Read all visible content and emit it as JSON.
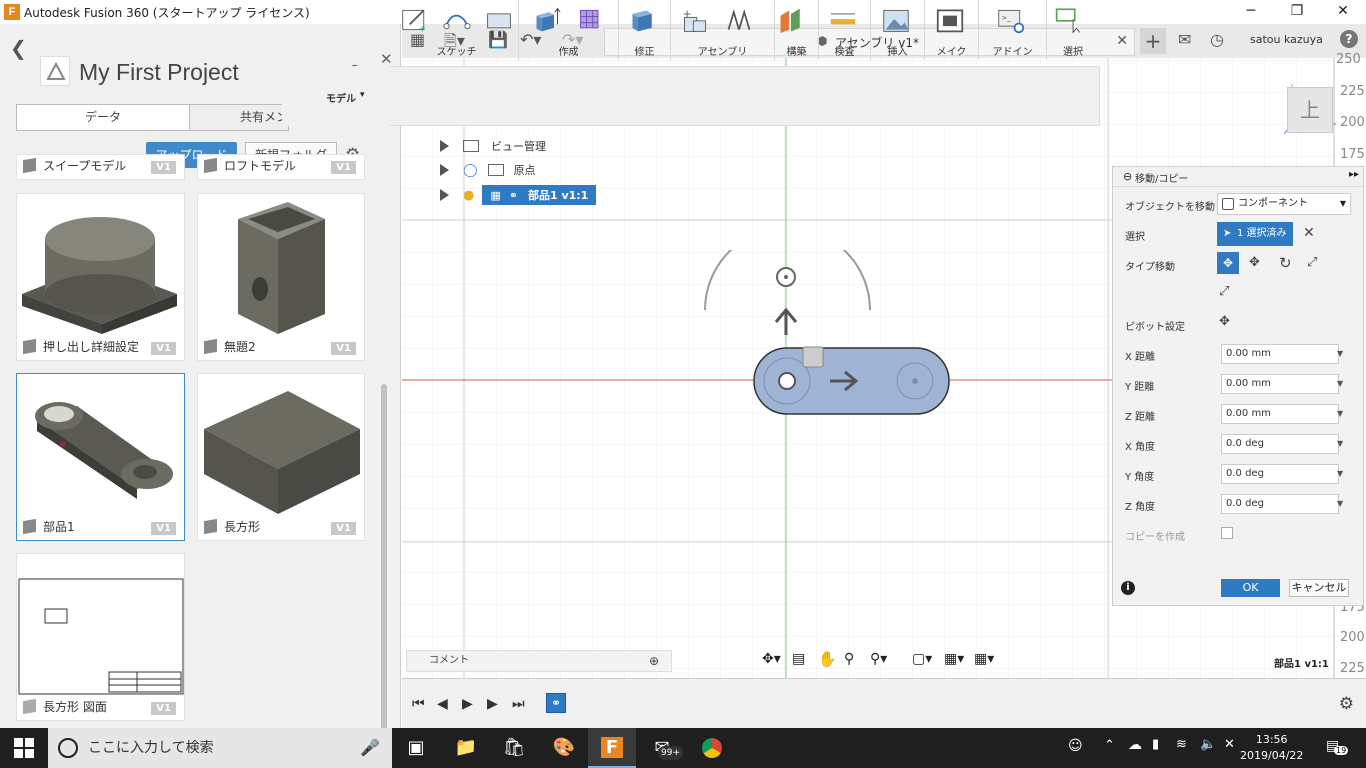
{
  "window": {
    "title": "Autodesk Fusion 360 (スタートアップ ライセンス)",
    "logo_letter": "F",
    "minimize": "─",
    "maximize": "❐",
    "close": "✕"
  },
  "data_panel": {
    "project_title": "My First Project",
    "tabs": [
      "データ",
      "共有メン"
    ],
    "upload_label": "アップロード",
    "new_folder_label": "新規フォルダ",
    "items": [
      {
        "name": "スイープモデル",
        "version": "V1"
      },
      {
        "name": "ロフトモデル",
        "version": "V1"
      },
      {
        "name": "押し出し詳細設定",
        "version": "V1"
      },
      {
        "name": "無題2",
        "version": "V1"
      },
      {
        "name": "部品1",
        "version": "V1"
      },
      {
        "name": "長方形",
        "version": "V1"
      },
      {
        "name": "長方形 図面",
        "version": "V1"
      }
    ]
  },
  "doc_tab": {
    "label": "アセンブリ v1*"
  },
  "user": {
    "name": "satou kazuya"
  },
  "ribbon": {
    "workspace": "モデル",
    "groups": [
      "スケッチ",
      "作成",
      "修正",
      "アセンブリ",
      "構築",
      "検査",
      "挿入",
      "メイク",
      "アドイン",
      "選択"
    ]
  },
  "browser": {
    "rows": [
      {
        "label": "ビュー管理"
      },
      {
        "label": "原点"
      },
      {
        "label": "部品1 v1:1"
      }
    ]
  },
  "viewcube": {
    "face": "上"
  },
  "ruler_ticks": [
    "250",
    "225",
    "200",
    "175",
    "175",
    "200",
    "225"
  ],
  "dialog": {
    "title": "移動/コピー",
    "move_object_label": "オブジェクトを移動",
    "move_object_value": "コンポーネント",
    "select_label": "選択",
    "select_value": "1 選択済み",
    "move_type_label": "タイプ移動",
    "pivot_label": "ピボット設定",
    "fields": [
      {
        "label": "X 距離",
        "value": "0.00 mm"
      },
      {
        "label": "Y 距離",
        "value": "0.00 mm"
      },
      {
        "label": "Z 距離",
        "value": "0.00 mm"
      },
      {
        "label": "X 角度",
        "value": "0.0 deg"
      },
      {
        "label": "Y 角度",
        "value": "0.0 deg"
      },
      {
        "label": "Z 角度",
        "value": "0.0 deg"
      }
    ],
    "copy_label": "コピーを作成",
    "ok_label": "OK",
    "cancel_label": "キャンセル"
  },
  "status_component": "部品1 v1:1",
  "comment_label": "コメント",
  "taskbar": {
    "search_placeholder": "ここに入力して検索",
    "badge": "99+",
    "time": "13:56",
    "date": "2019/04/22",
    "notif_count": "19"
  },
  "colors": {
    "accent": "#3f8acb",
    "part_fill": "#9fb3d4",
    "axis_red": "#e05050",
    "axis_green": "#70d070"
  }
}
